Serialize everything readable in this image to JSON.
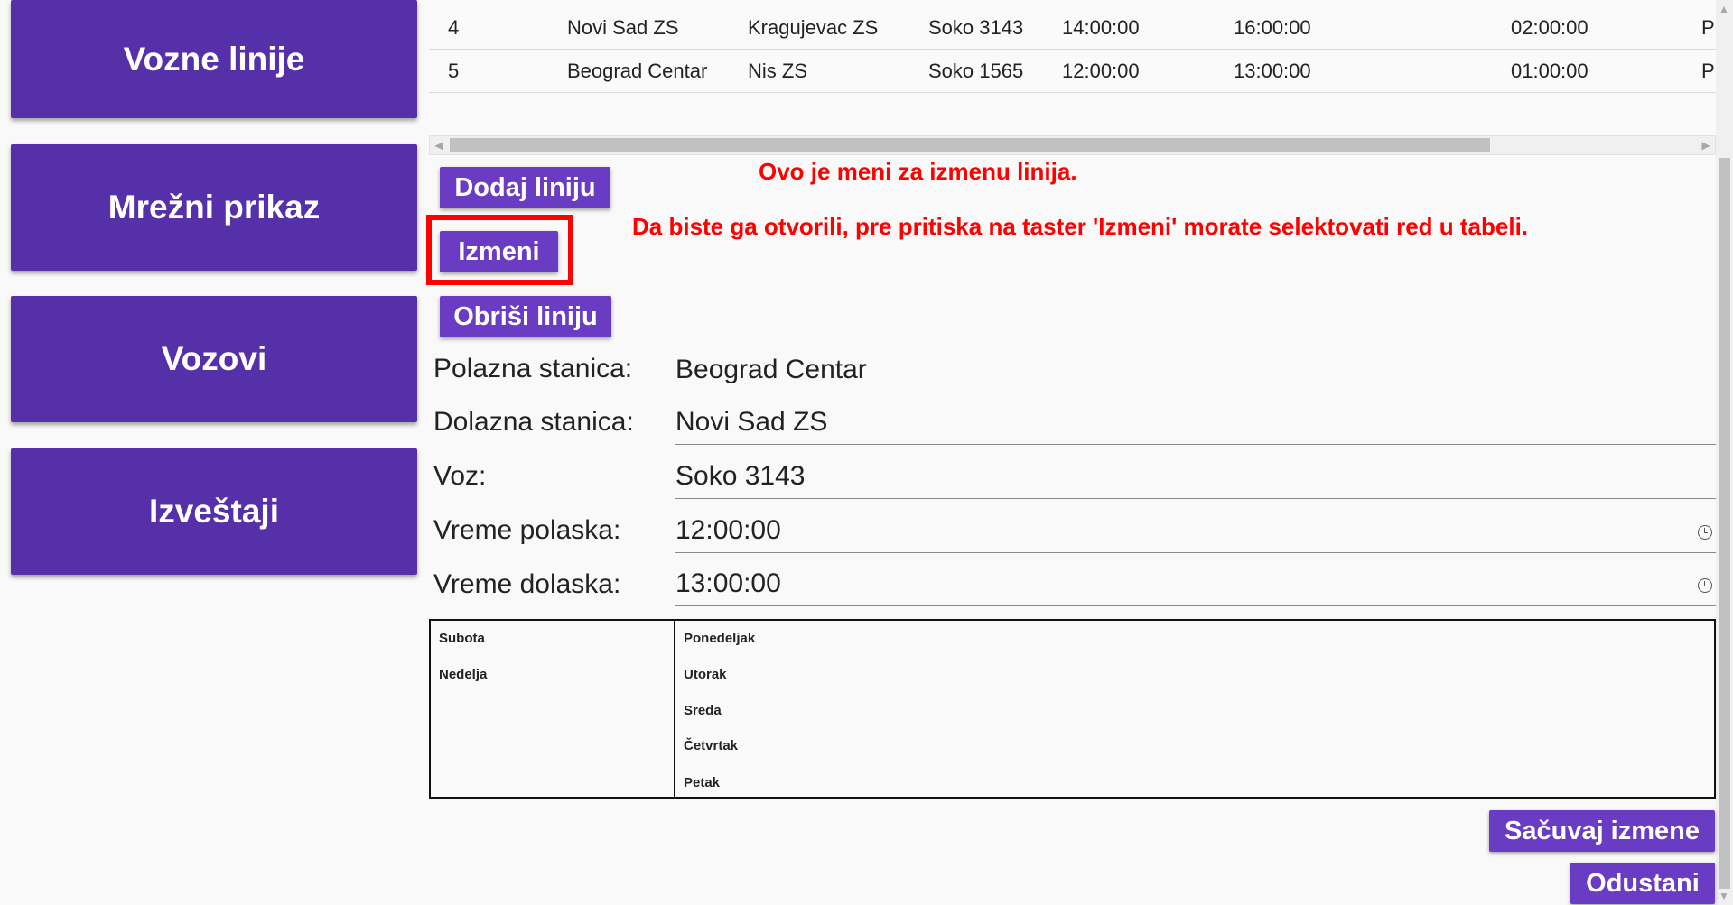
{
  "sidebar": {
    "items": [
      {
        "label": "Vozne linije"
      },
      {
        "label": "Mrežni prikaz"
      },
      {
        "label": "Vozovi"
      },
      {
        "label": "Izveštaji"
      }
    ]
  },
  "table": {
    "rows": [
      {
        "id": "4",
        "from": "Novi Sad ZS",
        "to": "Kragujevac ZS",
        "train": "Soko 3143",
        "departure": "14:00:00",
        "arrival": "16:00:00",
        "duration": "02:00:00",
        "extra": "P"
      },
      {
        "id": "5",
        "from": "Beograd Centar",
        "to": "Nis ZS",
        "train": "Soko 1565",
        "departure": "12:00:00",
        "arrival": "13:00:00",
        "duration": "01:00:00",
        "extra": "P"
      }
    ]
  },
  "actions": {
    "add_label": "Dodaj liniju",
    "edit_label": "Izmeni",
    "delete_label": "Obriši liniju",
    "save_label": "Sačuvaj izmene",
    "cancel_label": "Odustani"
  },
  "notes": {
    "line1": "Ovo je meni za izmenu linija.",
    "line2": "Da biste ga otvorili, pre pritiska na taster 'Izmeni' morate selektovati red u tabeli."
  },
  "form": {
    "departure_station_label": "Polazna stanica:",
    "departure_station_value": "Beograd Centar",
    "arrival_station_label": "Dolazna stanica:",
    "arrival_station_value": "Novi Sad ZS",
    "train_label": "Voz:",
    "train_value": "Soko 3143",
    "departure_time_label": "Vreme polaska:",
    "departure_time_value": "12:00:00",
    "arrival_time_label": "Vreme dolaska:",
    "arrival_time_value": "13:00:00"
  },
  "days": {
    "available": [
      "Subota",
      "Nedelja"
    ],
    "selected": [
      "Ponedeljak",
      "Utorak",
      "Sreda",
      "Četvrtak",
      "Petak"
    ]
  },
  "colors": {
    "primary": "#5530a8",
    "button": "#6a3cc4",
    "highlight": "#ff0000"
  }
}
